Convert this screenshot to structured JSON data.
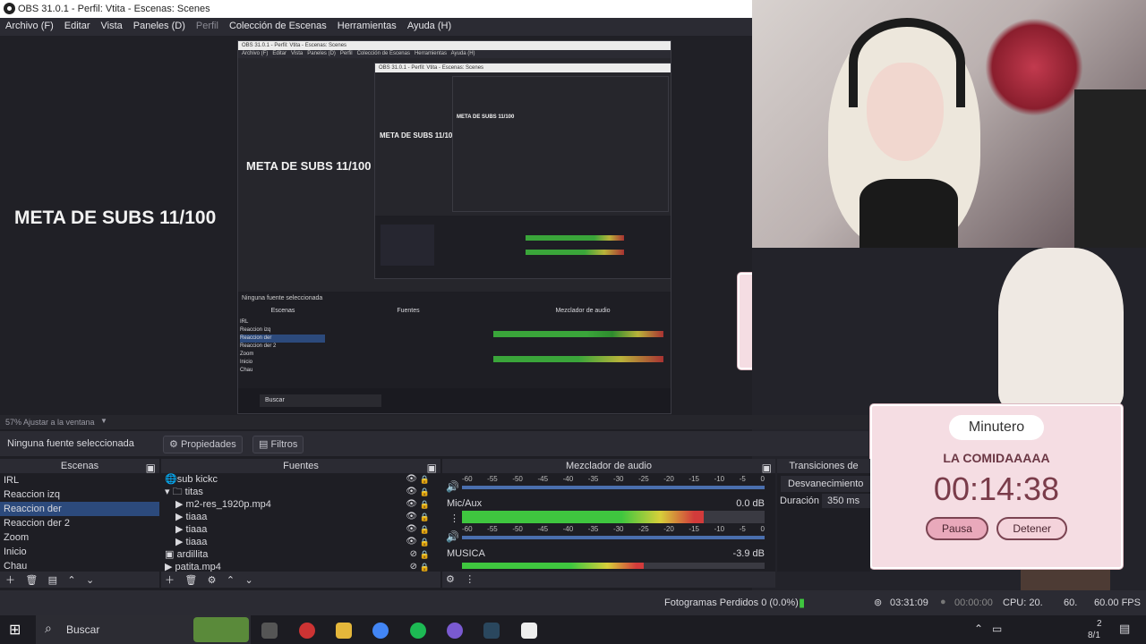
{
  "window": {
    "title": "OBS 31.0.1 - Perfil: Vtita - Escenas: Scenes"
  },
  "menu": [
    {
      "label": "Archivo (F)"
    },
    {
      "label": "Editar"
    },
    {
      "label": "Vista"
    },
    {
      "label": "Paneles (D)"
    },
    {
      "label": "Perfil"
    },
    {
      "label": "Colección de Escenas"
    },
    {
      "label": "Herramientas"
    },
    {
      "label": "Ayuda (H)"
    }
  ],
  "overlay_text": "META DE SUBS 11/100",
  "timer_widget": {
    "title": "Minutero",
    "label": "LA COMIDAAAAA",
    "time": "00:14:38",
    "pause_label": "Pausa",
    "stop_label": "Detener"
  },
  "zoom": {
    "label": "57% Ajustar a la ventana"
  },
  "source_bar": {
    "status": "Ninguna fuente seleccionada",
    "properties_label": "Propiedades",
    "filters_label": "Filtros"
  },
  "docks": {
    "scenes": {
      "title": "Escenas",
      "items": [
        {
          "label": "IRL"
        },
        {
          "label": "Reaccion izq"
        },
        {
          "label": "Reaccion der"
        },
        {
          "label": "Reaccion der 2"
        },
        {
          "label": "Zoom"
        },
        {
          "label": "Inicio"
        },
        {
          "label": "Chau"
        }
      ],
      "selected_index": 2
    },
    "sources": {
      "title": "Fuentes",
      "items": [
        {
          "label": "sub kickc",
          "indent": 0,
          "icon": "globe-icon"
        },
        {
          "label": "titas",
          "indent": 1,
          "icon": "folder-icon"
        },
        {
          "label": "m2-res_1920p.mp4",
          "indent": 2,
          "icon": "play-icon"
        },
        {
          "label": "tiaaa",
          "indent": 2,
          "icon": "play-icon"
        },
        {
          "label": "tiaaa",
          "indent": 2,
          "icon": "play-icon"
        },
        {
          "label": "tiaaa",
          "indent": 2,
          "icon": "play-icon"
        },
        {
          "label": "ardillita",
          "indent": 0,
          "icon": "image-icon"
        },
        {
          "label": "patita.mp4",
          "indent": 0,
          "icon": "play-icon"
        }
      ]
    },
    "mixer": {
      "title": "Mezclador de audio",
      "ticks": [
        "-60",
        "-55",
        "-50",
        "-45",
        "-40",
        "-35",
        "-30",
        "-25",
        "-20",
        "-15",
        "-10",
        "-5",
        "0"
      ],
      "channels": [
        {
          "name": "Mic/Aux",
          "db": "0.0 dB",
          "level": 0.8
        },
        {
          "name": "MUSICA",
          "db": "-3.9 dB",
          "level": 0.6
        }
      ]
    },
    "transitions": {
      "title": "Transiciones de",
      "type": "Desvanecimiento",
      "duration_label": "Duración",
      "duration_value": "350 ms"
    }
  },
  "status": {
    "frames_lost": "Fotogramas Perdidos 0 (0.0%)",
    "live_time": "03:31:09",
    "rec_time": "00:00:00",
    "cpu": "CPU: 20.",
    "fps": "60.00 FPS",
    "fps_prefix": "60."
  },
  "taskbar": {
    "search_label": "Buscar",
    "clock_time": "2",
    "clock_date": "8/1"
  }
}
